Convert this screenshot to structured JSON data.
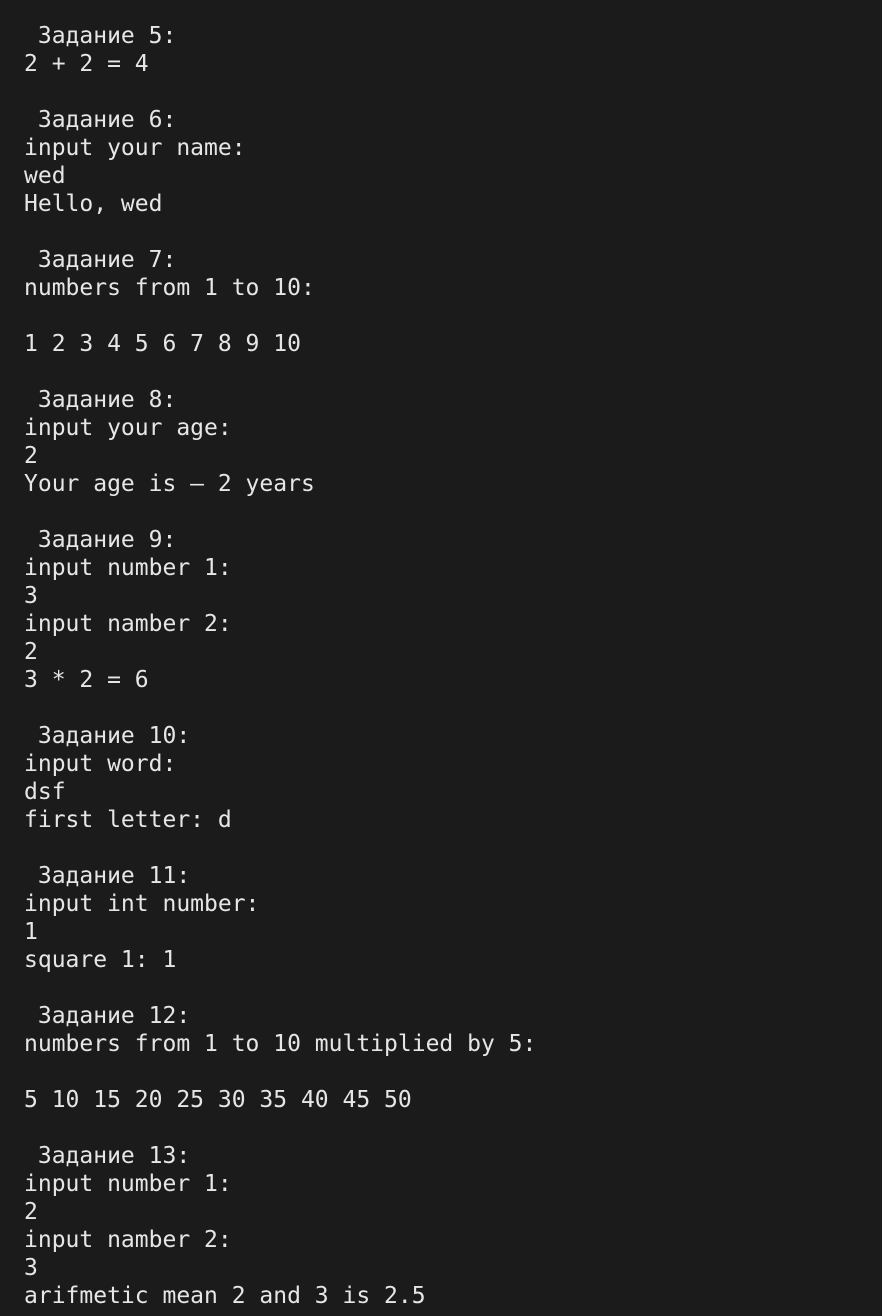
{
  "terminal": {
    "lines": [
      " Задание 5:",
      "2 + 2 = 4",
      "",
      " Задание 6:",
      "input your name:",
      "wed",
      "Hello, wed",
      "",
      " Задание 7:",
      "numbers from 1 to 10:",
      "",
      "1 2 3 4 5 6 7 8 9 10",
      "",
      " Задание 8:",
      "input your age:",
      "2",
      "Your age is – 2 years",
      "",
      " Задание 9:",
      "input number 1:",
      "3",
      "input namber 2:",
      "2",
      "3 * 2 = 6",
      "",
      " Задание 10:",
      "input word:",
      "dsf",
      "first letter: d",
      "",
      " Задание 11:",
      "input int number:",
      "1",
      "square 1: 1",
      "",
      " Задание 12:",
      "numbers from 1 to 10 multiplied by 5:",
      "",
      "5 10 15 20 25 30 35 40 45 50",
      "",
      " Задание 13:",
      "input number 1:",
      "2",
      "input namber 2:",
      "3",
      "arifmetic mean 2 and 3 is 2.5"
    ]
  }
}
